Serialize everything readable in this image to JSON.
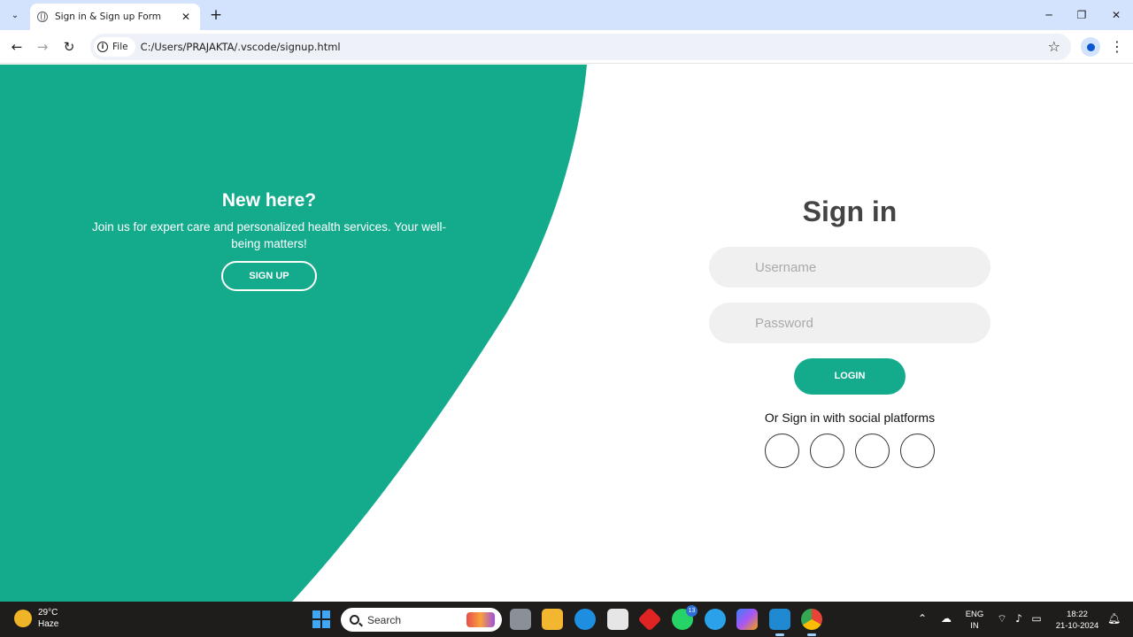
{
  "browser": {
    "tab_title": "Sign in & Sign up Form",
    "tab_close": "✕",
    "new_tab": "+",
    "chip_label": "File",
    "url": "C:/Users/PRAJAKTA/.vscode/signup.html"
  },
  "page": {
    "panel_color": "#14ab8d",
    "left": {
      "title": "New here?",
      "text": "Join us for expert care and personalized health services. Your well-being matters!",
      "signup_label": "SIGN UP"
    },
    "form": {
      "title": "Sign in",
      "username_placeholder": "Username",
      "password_placeholder": "Password",
      "login_label": "LOGIN",
      "social_text": "Or Sign in with social platforms",
      "social_icons": [
        "social-icon-1",
        "social-icon-2",
        "social-icon-3",
        "social-icon-4"
      ]
    }
  },
  "taskbar": {
    "weather_temp": "29°C",
    "weather_desc": "Haze",
    "search_label": "Search",
    "whatsapp_badge": "13",
    "lang_line1": "ENG",
    "lang_line2": "IN",
    "time": "18:22",
    "date": "21-10-2024"
  }
}
